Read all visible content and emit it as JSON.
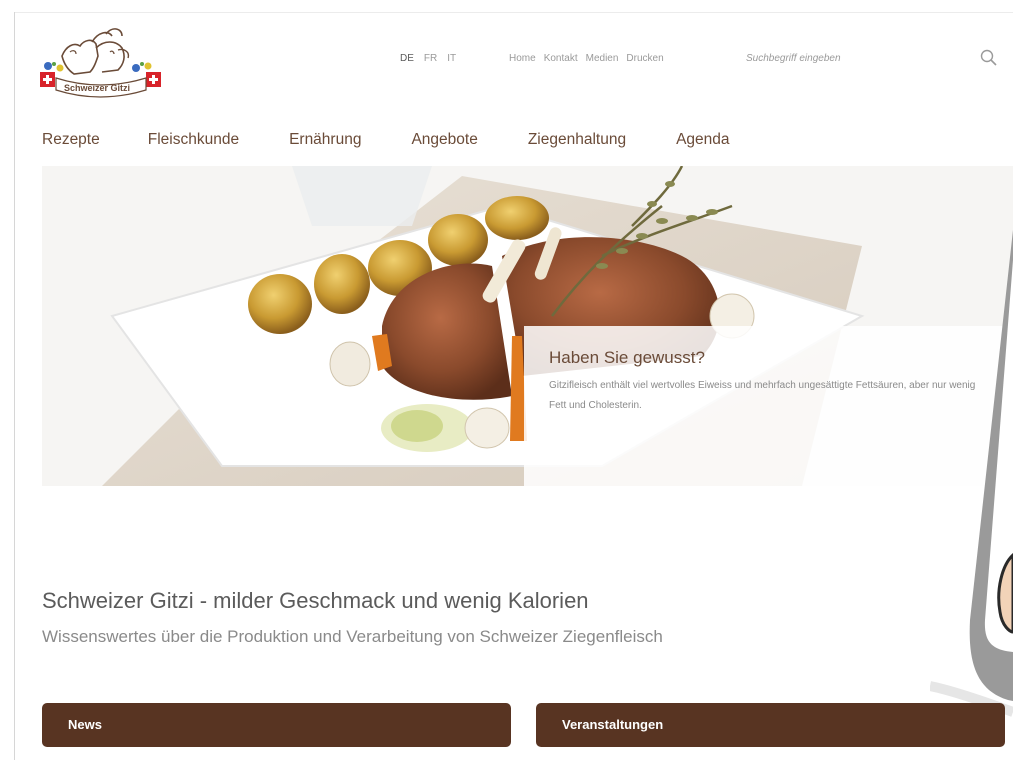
{
  "logo": {
    "text": "Schweizer Gitzi"
  },
  "language": {
    "items": [
      "DE",
      "FR",
      "IT"
    ],
    "active": "DE"
  },
  "utility_nav": {
    "items": [
      "Home",
      "Kontakt",
      "Medien",
      "Drucken"
    ]
  },
  "search": {
    "placeholder": "Suchbegriff eingeben",
    "icon": "magnifier"
  },
  "main_nav": {
    "items": [
      "Rezepte",
      "Fleischkunde",
      "Ernährung",
      "Angebote",
      "Ziegenhaltung",
      "Agenda"
    ]
  },
  "hero": {
    "info_title": "Haben Sie gewusst?",
    "info_text": "Gitzifleisch enthält viel wertvolles Eiweiss und mehrfach ungesättigte Fettsäuren, aber nur wenig Fett und Cholesterin."
  },
  "content": {
    "headline": "Schweizer Gitzi - milder Geschmack und wenig Kalorien",
    "subline": "Wissenswertes über die Produktion und Verarbeitung von Schweizer Ziegenfleisch"
  },
  "sections": {
    "news": "News",
    "events": "Veranstaltungen"
  },
  "colors": {
    "brand_brown": "#583422",
    "nav_brown": "#6a4b38",
    "swiss_red": "#d8232a"
  }
}
